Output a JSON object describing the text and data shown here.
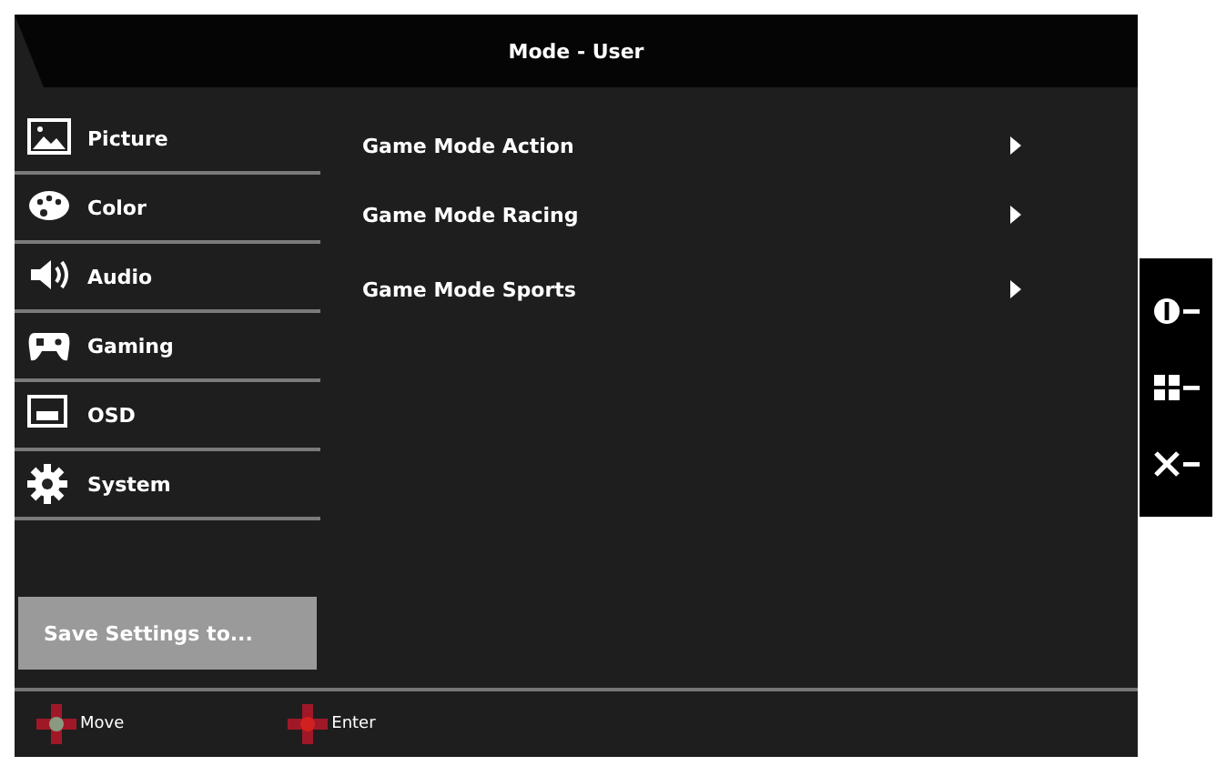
{
  "window": {
    "title": "Mode - User"
  },
  "sidebar": {
    "items": [
      {
        "label": "Picture"
      },
      {
        "label": "Color"
      },
      {
        "label": "Audio"
      },
      {
        "label": "Gaming"
      },
      {
        "label": "OSD"
      },
      {
        "label": "System"
      }
    ]
  },
  "menu": {
    "items": [
      {
        "label": "Game Mode Action"
      },
      {
        "label": "Game Mode Racing"
      },
      {
        "label": "Game Mode Sports"
      }
    ]
  },
  "save_button": {
    "label": "Save Settings to..."
  },
  "footer": {
    "hints": [
      {
        "label": "Move"
      },
      {
        "label": "Enter"
      }
    ]
  }
}
